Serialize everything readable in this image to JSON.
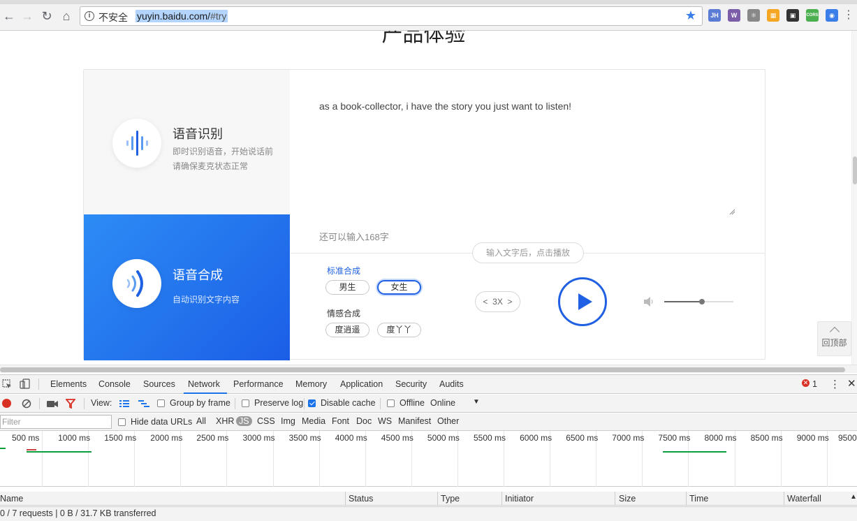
{
  "browser": {
    "insecure_label": "不安全",
    "url_host": "yuyin.baidu.com/",
    "url_fragment": "#try",
    "extensions": [
      {
        "name": "jh-extension-icon",
        "label": "JH",
        "color": "#5b7bd5"
      },
      {
        "name": "wappalyzer-icon",
        "label": "W",
        "color": "#7b5ea7"
      },
      {
        "name": "react-devtools-icon",
        "label": "⚛",
        "color": "#888888"
      },
      {
        "name": "grid-extension-icon",
        "label": "▦",
        "color": "#f5a623"
      },
      {
        "name": "qr-code-icon",
        "label": "▣",
        "color": "#333333"
      },
      {
        "name": "cors-icon",
        "label": "CORS",
        "color": "#4caf50"
      },
      {
        "name": "globe-extension-icon",
        "label": "◉",
        "color": "#3b7de9"
      }
    ]
  },
  "page": {
    "heading": "产品体验",
    "recognition": {
      "title": "语音识别",
      "desc_line1": "即时识别语音，开始说话前",
      "desc_line2": "请确保麦克状态正常"
    },
    "synthesis": {
      "title": "语音合成",
      "desc": "自动识别文字内容"
    },
    "input_text": "as a book-collector, i have the story you just want to listen!",
    "remaining": "还可以输入168字",
    "hint": "输入文字后，点击播放",
    "standard_label": "标准合成",
    "emotion_label": "情感合成",
    "voices": {
      "male": "男生",
      "female": "女生",
      "emo1": "度逍遥",
      "emo2": "度丫丫"
    },
    "speed": "3X",
    "volume_level": 0.55,
    "back_to_top": "回顶部",
    "accent_color": "#2061e3"
  },
  "devtools": {
    "tabs": [
      "Elements",
      "Console",
      "Sources",
      "Network",
      "Performance",
      "Memory",
      "Application",
      "Security",
      "Audits"
    ],
    "active_tab": "Network",
    "error_count": "1",
    "toolbar": {
      "view_label": "View:",
      "group_by_frame": "Group by frame",
      "preserve_log": "Preserve log",
      "disable_cache": "Disable cache",
      "offline": "Offline",
      "throttle": "Online"
    },
    "filter_placeholder": "Filter",
    "hide_data_urls": "Hide data URLs",
    "type_filters": [
      "All",
      "XHR",
      "JS",
      "CSS",
      "Img",
      "Media",
      "Font",
      "Doc",
      "WS",
      "Manifest",
      "Other"
    ],
    "active_type_filter": "JS",
    "timeline_ticks": [
      "500 ms",
      "1000 ms",
      "1500 ms",
      "2000 ms",
      "2500 ms",
      "3000 ms",
      "3500 ms",
      "4000 ms",
      "4500 ms",
      "5000 ms",
      "5500 ms",
      "6000 ms",
      "6500 ms",
      "7000 ms",
      "7500 ms",
      "8000 ms",
      "8500 ms",
      "9000 ms",
      "9500"
    ],
    "columns": [
      "Name",
      "Status",
      "Type",
      "Initiator",
      "Size",
      "Time",
      "Waterfall"
    ],
    "status_text": "0 / 7 requests | 0 B / 31.7 KB transferred"
  }
}
